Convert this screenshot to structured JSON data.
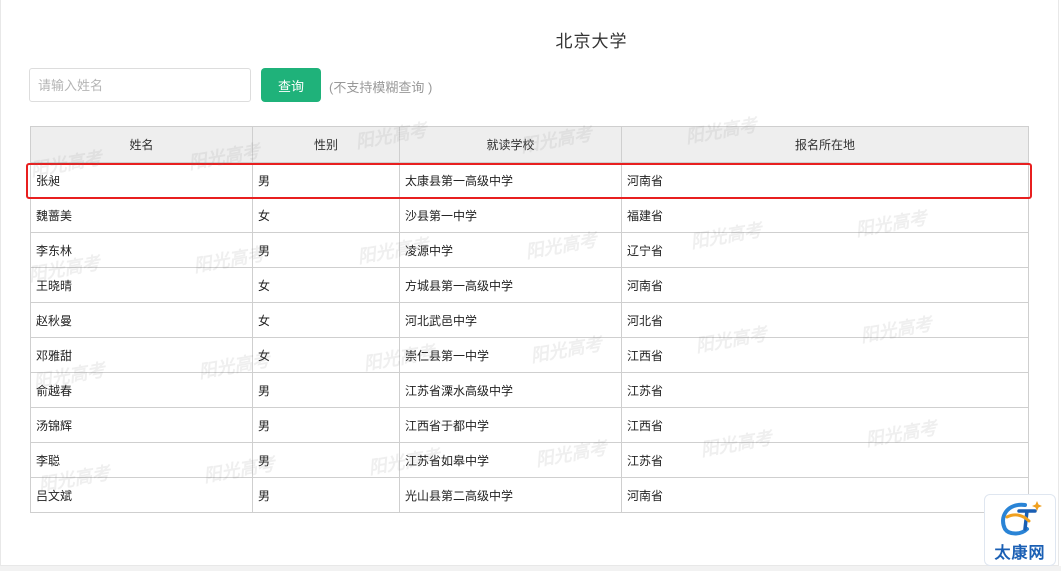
{
  "page_title": "北京大学",
  "search": {
    "placeholder": "请输入姓名",
    "button_label": "查询",
    "hint": "(不支持模糊查询 )"
  },
  "table": {
    "headers": [
      "姓名",
      "性别",
      "就读学校",
      "报名所在地"
    ],
    "rows": [
      [
        "张昶",
        "男",
        "太康县第一高级中学",
        "河南省"
      ],
      [
        "魏蔷美",
        "女",
        "沙县第一中学",
        "福建省"
      ],
      [
        "李东林",
        "男",
        "凌源中学",
        "辽宁省"
      ],
      [
        "王晓晴",
        "女",
        "方城县第一高级中学",
        "河南省"
      ],
      [
        "赵秋曼",
        "女",
        "河北武邑中学",
        "河北省"
      ],
      [
        "邓雅甜",
        "女",
        "崇仁县第一中学",
        "江西省"
      ],
      [
        "俞越春",
        "男",
        "江苏省溧水高级中学",
        "江苏省"
      ],
      [
        "汤锦辉",
        "男",
        "江西省于都中学",
        "江西省"
      ],
      [
        "李聪",
        "男",
        "江苏省如皋中学",
        "江苏省"
      ],
      [
        "吕文斌",
        "男",
        "光山县第二高级中学",
        "河南省"
      ]
    ]
  },
  "watermark_text": "阳光高考",
  "logo": {
    "text": "太康网",
    "icon": "tc-logo-icon"
  },
  "colors": {
    "button": "#1fb27a",
    "highlight": "#e81f1f",
    "header_bg": "#eeeeee",
    "logo": "#1a5fb4"
  }
}
